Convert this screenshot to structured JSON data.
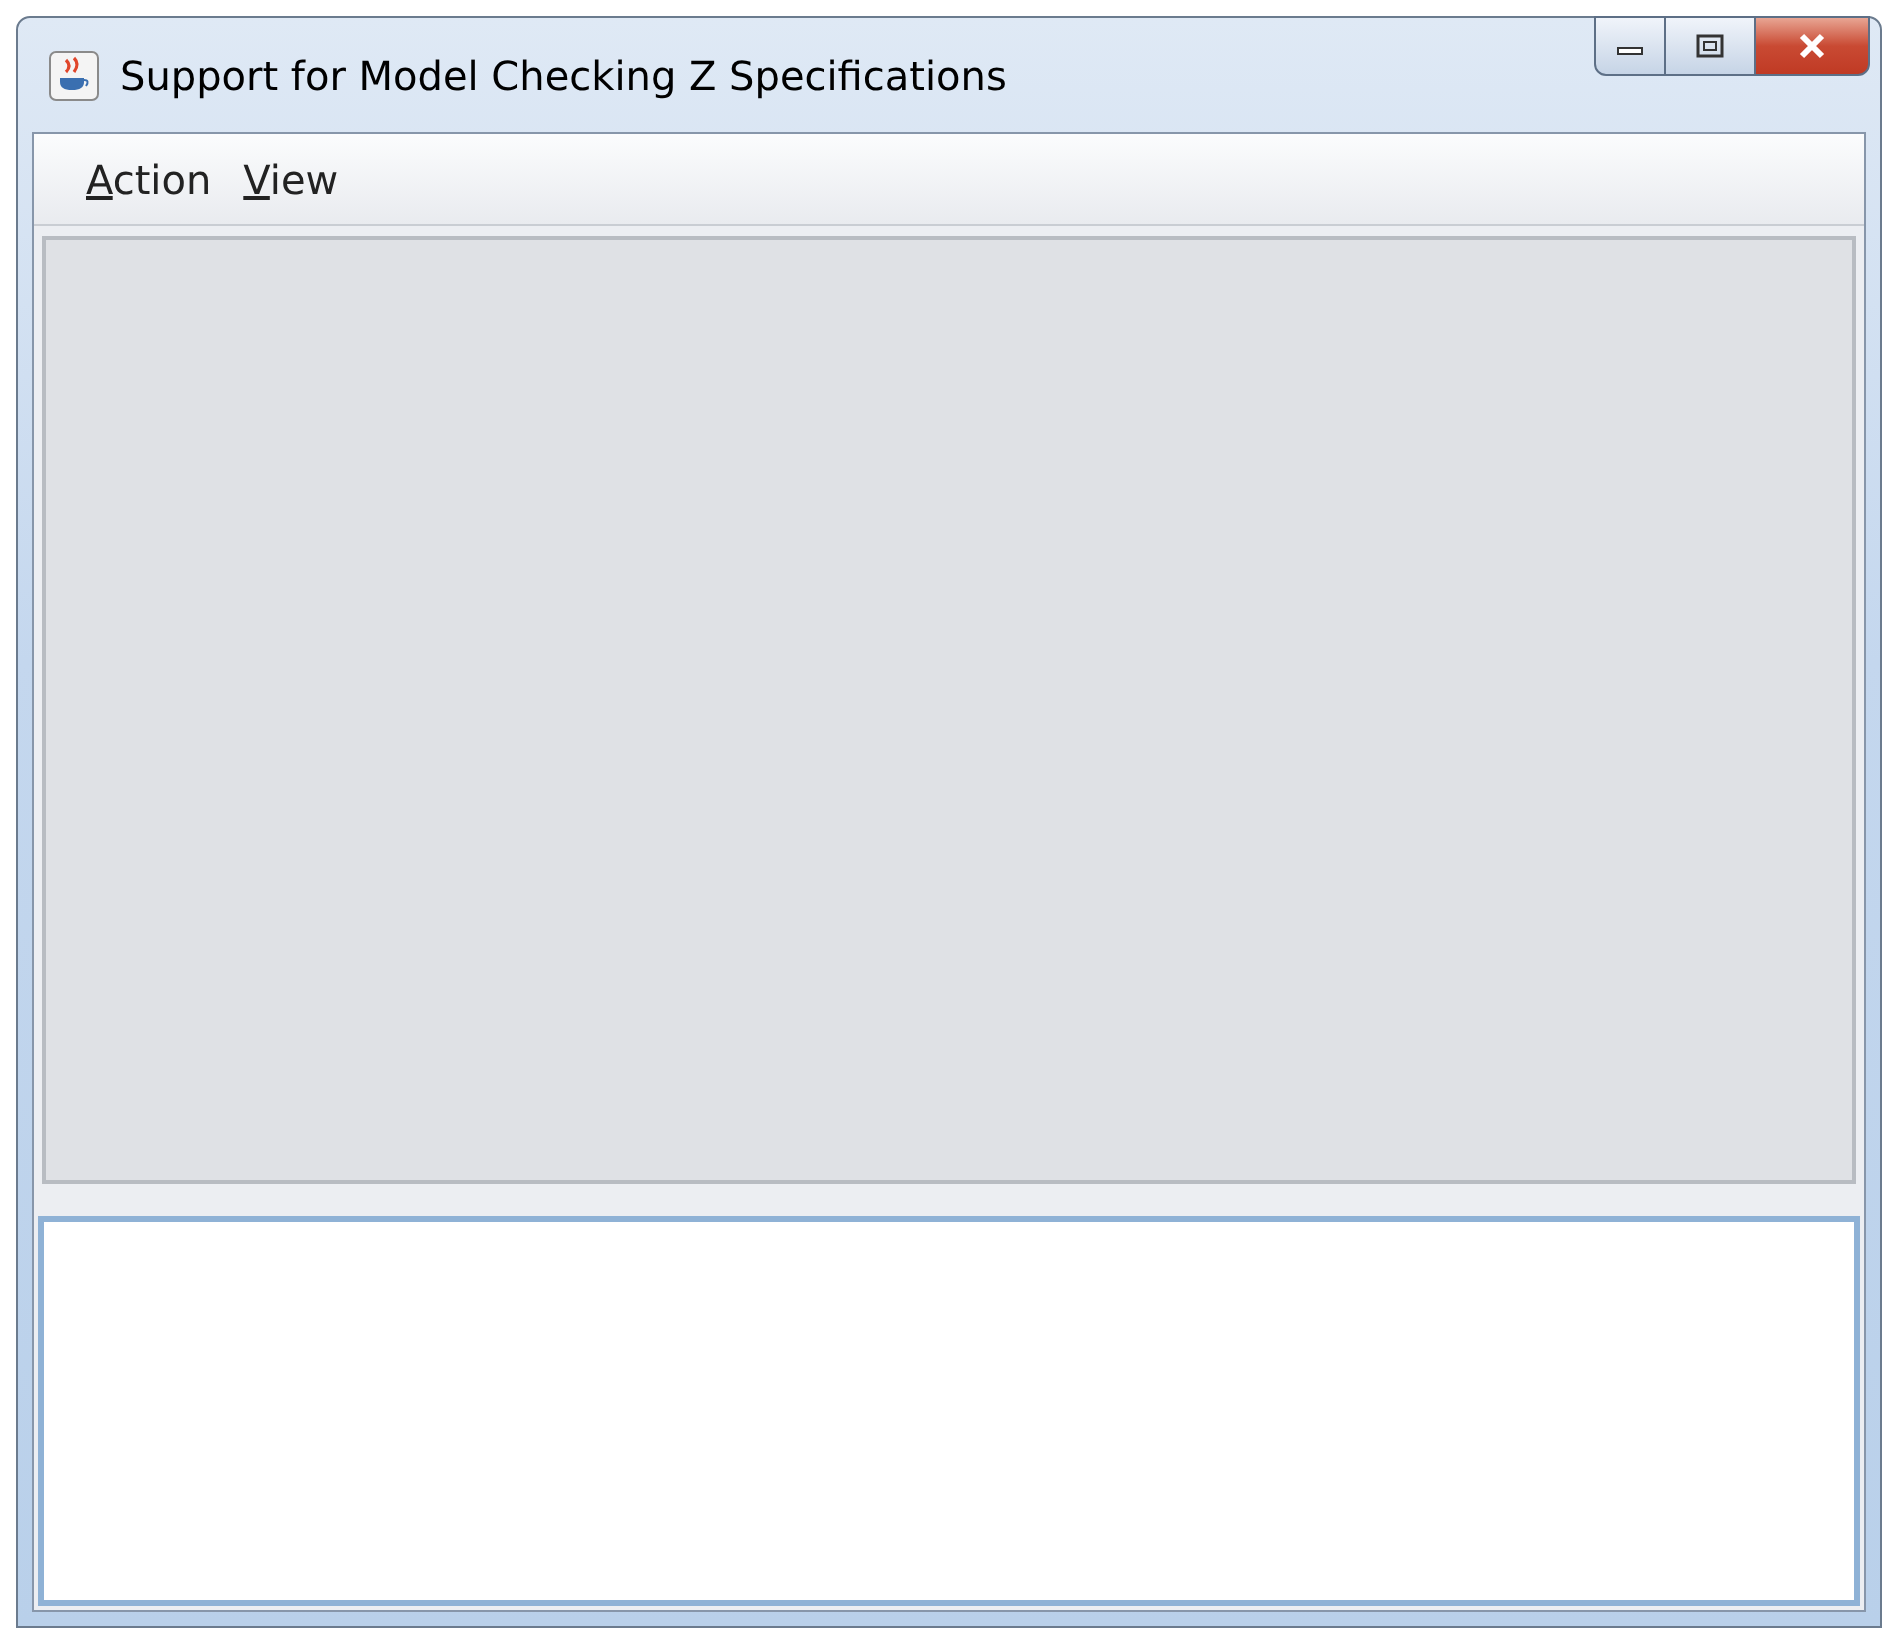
{
  "window": {
    "title": "Support for Model Checking Z Specifications"
  },
  "menu": [
    {
      "label": "Action"
    },
    {
      "label": "View"
    }
  ]
}
